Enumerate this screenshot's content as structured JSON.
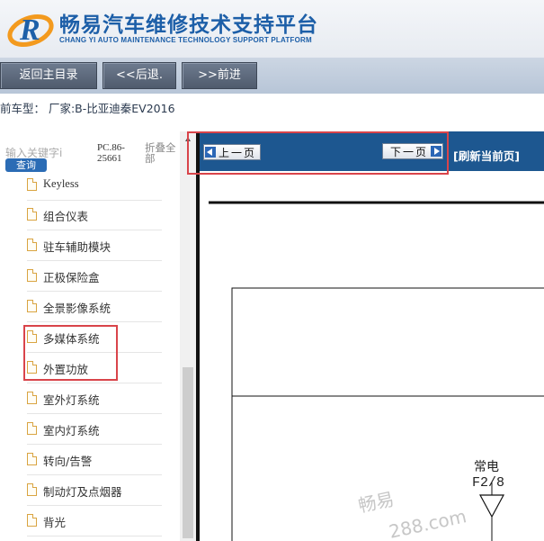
{
  "header": {
    "brand_cn": "畅易汽车维修技术支持平台",
    "brand_en": "CHANG YI AUTO MAINTENANCE TECHNOLOGY SUPPORT PLATFORM",
    "logo_letter": "R"
  },
  "nav": {
    "home_label": "返回主目录",
    "back_label": "<<后退.",
    "forward_label": ">>前进"
  },
  "vehicle": {
    "label": "前车型：   厂家:B-比亚迪秦EV2016"
  },
  "left_panel": {
    "search_placeholder": "输入关键字i",
    "search_button": "查询",
    "code": "PC.86-25661",
    "collapse_label": "折叠全部",
    "tree_items": [
      "Keyless",
      "组合仪表",
      "驻车辅助模块",
      "正极保险盒",
      "全景影像系统",
      "多媒体系统",
      "外置功放",
      "室外灯系统",
      "室内灯系统",
      "转向/告警",
      "制动灯及点烟器",
      "背光"
    ]
  },
  "pager": {
    "prev_label": "上一页",
    "next_label": "下一页",
    "refresh_label": "[刷新当前页]"
  },
  "diagram": {
    "power_label": "常电",
    "fuse_label": "F2/8"
  },
  "watermark": {
    "line1": "畅易",
    "line2": "288.com"
  },
  "colors": {
    "brand_blue": "#1d5fa8",
    "pager_blue": "#1d5790",
    "highlight_red": "#d9444a",
    "nav_gray": "#5e6a7c"
  }
}
